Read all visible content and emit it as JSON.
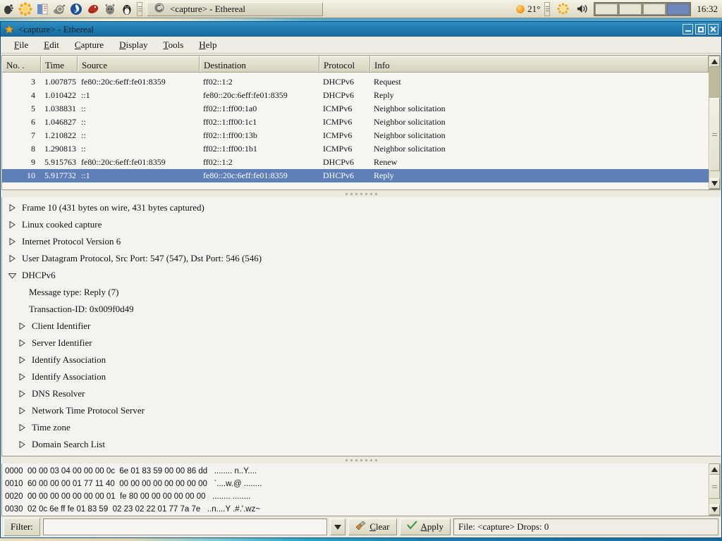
{
  "taskbar": {
    "launchers": [
      {
        "name": "gnome-foot-icon",
        "glyph": "👣"
      },
      {
        "name": "sunflower-icon",
        "glyph": "✻"
      },
      {
        "name": "text-editor-icon",
        "glyph": "📓"
      },
      {
        "name": "snail-help-icon",
        "glyph": "🐌"
      },
      {
        "name": "mozilla-icon",
        "glyph": "🔥"
      },
      {
        "name": "mozilla-dino-icon",
        "glyph": "🦖"
      },
      {
        "name": "gnu-icon",
        "glyph": "🐐"
      },
      {
        "name": "tux-linux-icon",
        "glyph": "🐧"
      }
    ],
    "task_button": {
      "label": "<capture> - Ethereal",
      "icon": "ethereal-icon"
    },
    "tray": {
      "temperature": "21°",
      "weather_icon": "sun-icon",
      "gear_icon": "gear-icon",
      "volume_icon": "speaker-icon",
      "workspaces": [
        "1",
        "2",
        "3",
        "4"
      ],
      "active_workspace": 4
    },
    "clock": "16:32"
  },
  "window": {
    "title": "<capture> - Ethereal",
    "title_icon": "star-icon",
    "buttons": {
      "minimize": "minimize-button",
      "maximize": "maximize-button",
      "close": "close-button"
    }
  },
  "menubar": [
    {
      "pre": "",
      "mn": "F",
      "post": "ile"
    },
    {
      "pre": "",
      "mn": "E",
      "post": "dit"
    },
    {
      "pre": "",
      "mn": "C",
      "post": "apture"
    },
    {
      "pre": "",
      "mn": "D",
      "post": "isplay"
    },
    {
      "pre": "",
      "mn": "T",
      "post": "ools"
    },
    {
      "pre": "",
      "mn": "H",
      "post": "elp"
    }
  ],
  "packet_list": {
    "columns": [
      {
        "label": "No. .",
        "sorted": true
      },
      {
        "label": "Time",
        "sorted": false
      },
      {
        "label": "Source",
        "sorted": false
      },
      {
        "label": "Destination",
        "sorted": false
      },
      {
        "label": "Protocol",
        "sorted": false
      },
      {
        "label": "Info",
        "sorted": false
      }
    ],
    "rows": [
      {
        "no": "3",
        "time": "1.007875",
        "source": "fe80::20c:6eff:fe01:8359",
        "destination": "ff02::1:2",
        "protocol": "DHCPv6",
        "info": "Request",
        "selected": false
      },
      {
        "no": "4",
        "time": "1.010422",
        "source": "::1",
        "destination": "fe80::20c:6eff:fe01:8359",
        "protocol": "DHCPv6",
        "info": "Reply",
        "selected": false
      },
      {
        "no": "5",
        "time": "1.038831",
        "source": "::",
        "destination": "ff02::1:ff00:1a0",
        "protocol": "ICMPv6",
        "info": "Neighbor solicitation",
        "selected": false
      },
      {
        "no": "6",
        "time": "1.046827",
        "source": "::",
        "destination": "ff02::1:ff00:1c1",
        "protocol": "ICMPv6",
        "info": "Neighbor solicitation",
        "selected": false
      },
      {
        "no": "7",
        "time": "1.210822",
        "source": "::",
        "destination": "ff02::1:ff00:13b",
        "protocol": "ICMPv6",
        "info": "Neighbor solicitation",
        "selected": false
      },
      {
        "no": "8",
        "time": "1.290813",
        "source": "::",
        "destination": "ff02::1:ff00:1b1",
        "protocol": "ICMPv6",
        "info": "Neighbor solicitation",
        "selected": false
      },
      {
        "no": "9",
        "time": "5.915763",
        "source": "fe80::20c:6eff:fe01:8359",
        "destination": "ff02::1:2",
        "protocol": "DHCPv6",
        "info": "Renew",
        "selected": false
      },
      {
        "no": "10",
        "time": "5.917732",
        "source": "::1",
        "destination": "fe80::20c:6eff:fe01:8359",
        "protocol": "DHCPv6",
        "info": "Reply",
        "selected": true
      }
    ]
  },
  "detail_tree": [
    {
      "label": "Frame 10 (431 bytes on wire, 431 bytes captured)",
      "state": "collapsed",
      "depth": 0
    },
    {
      "label": "Linux cooked capture",
      "state": "collapsed",
      "depth": 0
    },
    {
      "label": "Internet Protocol Version 6",
      "state": "collapsed",
      "depth": 0
    },
    {
      "label": "User Datagram Protocol, Src Port: 547 (547), Dst Port: 546 (546)",
      "state": "collapsed",
      "depth": 0
    },
    {
      "label": "DHCPv6",
      "state": "expanded",
      "depth": 0
    },
    {
      "label": "Message type: Reply (7)",
      "state": "leaf",
      "depth": 2
    },
    {
      "label": "Transaction-ID: 0x009f0d49",
      "state": "leaf",
      "depth": 2
    },
    {
      "label": "Client Identifier",
      "state": "collapsed",
      "depth": 1
    },
    {
      "label": "Server Identifier",
      "state": "collapsed",
      "depth": 1
    },
    {
      "label": "Identify Association",
      "state": "collapsed",
      "depth": 1
    },
    {
      "label": "Identify Association",
      "state": "collapsed",
      "depth": 1
    },
    {
      "label": "DNS Resolver",
      "state": "collapsed",
      "depth": 1
    },
    {
      "label": "Network Time Protocol Server",
      "state": "collapsed",
      "depth": 1
    },
    {
      "label": "Time zone",
      "state": "collapsed",
      "depth": 1
    },
    {
      "label": "Domain Search List",
      "state": "collapsed",
      "depth": 1
    }
  ],
  "hex_dump": [
    "0000  00 00 03 04 00 00 00 0c  6e 01 83 59 00 00 86 dd   ........ n..Y....",
    "0010  60 00 00 00 01 77 11 40  00 00 00 00 00 00 00 00   `....w.@ ........",
    "0020  00 00 00 00 00 00 00 01  fe 80 00 00 00 00 00 00   ........ ........",
    "0030  02 0c 6e ff fe 01 83 59  02 23 02 22 01 77 7a 7e   ..n....Y .#.'.wz~"
  ],
  "filterbar": {
    "label": "Filter:",
    "value": "",
    "placeholder": "",
    "dropdown_icon": "chevron-down-icon",
    "clear": {
      "pre": "",
      "mn": "C",
      "post": "lear",
      "icon": "broom-icon"
    },
    "apply": {
      "pre": "",
      "mn": "A",
      "post": "pply",
      "icon": "check-icon"
    },
    "status": "File: <capture>  Drops: 0"
  },
  "colors": {
    "selection": "#5f7fb8",
    "titlebar": "#1f78ad",
    "chrome": "#eceadf",
    "panel": "#f4f3ef"
  }
}
